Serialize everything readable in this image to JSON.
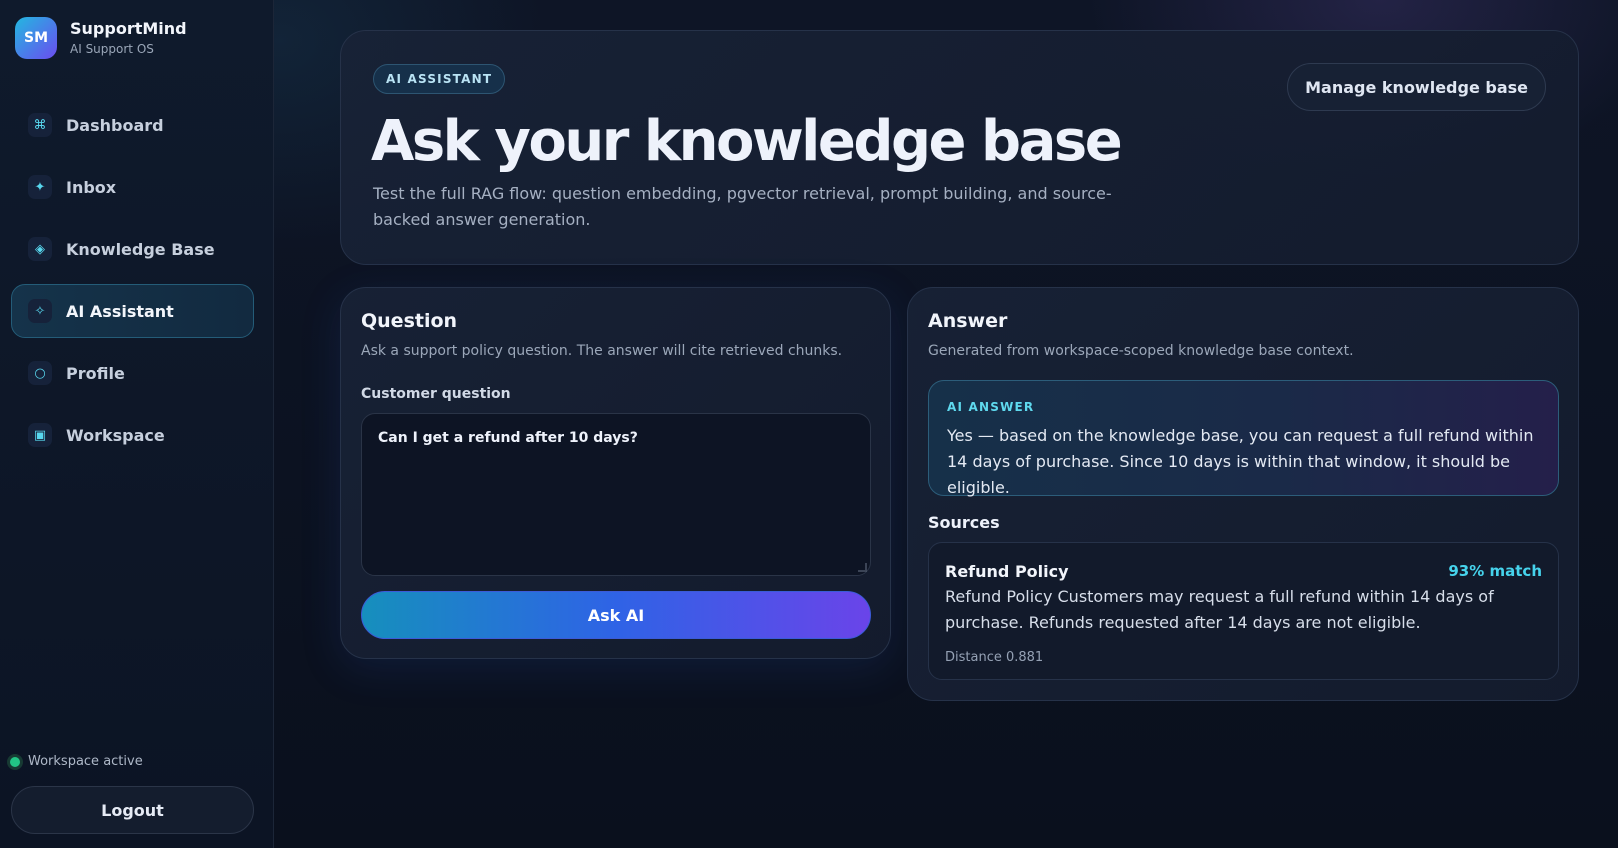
{
  "brand": {
    "logo_text": "SM",
    "name": "SupportMind",
    "subtitle": "AI Support OS"
  },
  "sidebar": {
    "items": [
      {
        "label": "Dashboard",
        "icon": "command-icon",
        "glyph": "⌘",
        "active": false
      },
      {
        "label": "Inbox",
        "icon": "sparkle-icon",
        "glyph": "✦",
        "active": false
      },
      {
        "label": "Knowledge Base",
        "icon": "diamond-icon",
        "glyph": "◈",
        "active": false
      },
      {
        "label": "AI Assistant",
        "icon": "star-outline-icon",
        "glyph": "✧",
        "active": true
      },
      {
        "label": "Profile",
        "icon": "circle-icon",
        "glyph": "○",
        "active": false
      },
      {
        "label": "Workspace",
        "icon": "square-icon",
        "glyph": "▣",
        "active": false
      }
    ],
    "workspace_status": "Workspace active",
    "logout_label": "Logout"
  },
  "hero": {
    "badge": "AI ASSISTANT",
    "title": "Ask your knowledge base",
    "description": "Test the full RAG flow: question embedding, pgvector retrieval, prompt building, and source-backed answer generation.",
    "manage_button": "Manage knowledge base"
  },
  "question": {
    "title": "Question",
    "subtitle": "Ask a support policy question. The answer will cite retrieved chunks.",
    "field_label": "Customer question",
    "field_value": "Can I get a refund after 10 days?",
    "ask_button": "Ask AI"
  },
  "answer": {
    "title": "Answer",
    "subtitle": "Generated from workspace-scoped knowledge base context.",
    "label": "AI ANSWER",
    "text": "Yes — based on the knowledge base, you can request a full refund within 14 days of purchase. Since 10 days is within that window, it should be eligible.",
    "sources_title": "Sources",
    "sources": [
      {
        "name": "Refund Policy",
        "match": "93% match",
        "text": "Refund Policy Customers may request a full refund within 14 days of purchase. Refunds requested after 14 days are not eligible.",
        "distance": "Distance 0.881"
      }
    ]
  },
  "colors": {
    "accent": "#46d3ec",
    "status_green": "#22c585",
    "button_start": "#168fbd",
    "button_end": "#6a44e9"
  }
}
